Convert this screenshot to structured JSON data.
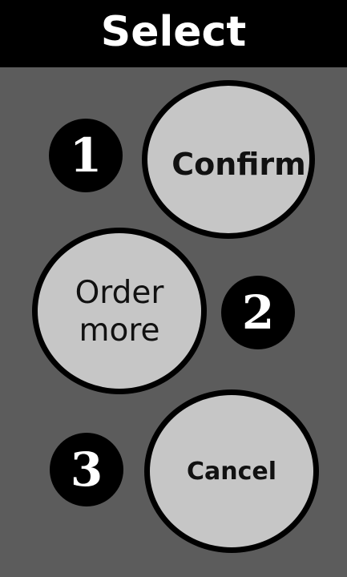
{
  "header": {
    "title": "Select"
  },
  "options": [
    {
      "number": "1",
      "label": "Confirm"
    },
    {
      "number": "2",
      "label": "Order\nmore"
    },
    {
      "number": "3",
      "label": "Cancel"
    }
  ],
  "colors": {
    "background": "#5c5c5c",
    "header_background": "#000000",
    "button_fill": "#c6c6c6",
    "button_border": "#000000",
    "badge_fill": "#000000",
    "badge_text": "#ffffff"
  }
}
